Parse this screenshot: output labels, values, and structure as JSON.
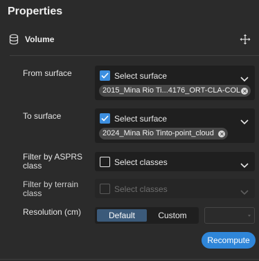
{
  "panel": {
    "title": "Properties"
  },
  "section": {
    "title": "Volume",
    "icon": "database-icon",
    "action_icon": "move-icon"
  },
  "fields": {
    "from_surface": {
      "label": "From surface",
      "placeholder": "Select surface",
      "checked": true,
      "chip": "2015_Mina Rio Ti...4176_ORT-CLA-COL"
    },
    "to_surface": {
      "label": "To surface",
      "placeholder": "Select surface",
      "checked": true,
      "chip": "2024_Mina Rio Tinto-point_cloud"
    },
    "asprs": {
      "label_line1": "Filter by ASPRS",
      "label_line2": "class",
      "placeholder": "Select classes",
      "checked": false
    },
    "terrain": {
      "label_line1": "Filter by terrain",
      "label_line2": "class",
      "placeholder": "Select classes",
      "checked": false,
      "disabled": true
    },
    "resolution": {
      "label": "Resolution (cm)",
      "options": [
        "Default",
        "Custom"
      ],
      "selected": "Default",
      "value": ""
    }
  },
  "actions": {
    "recompute": "Recompute"
  },
  "colors": {
    "accent": "#2f86d9",
    "checkbox": "#3d8fe0",
    "segment_active": "#3b5a7a",
    "background": "#2b2b2b",
    "panel": "#1f1f1f"
  }
}
